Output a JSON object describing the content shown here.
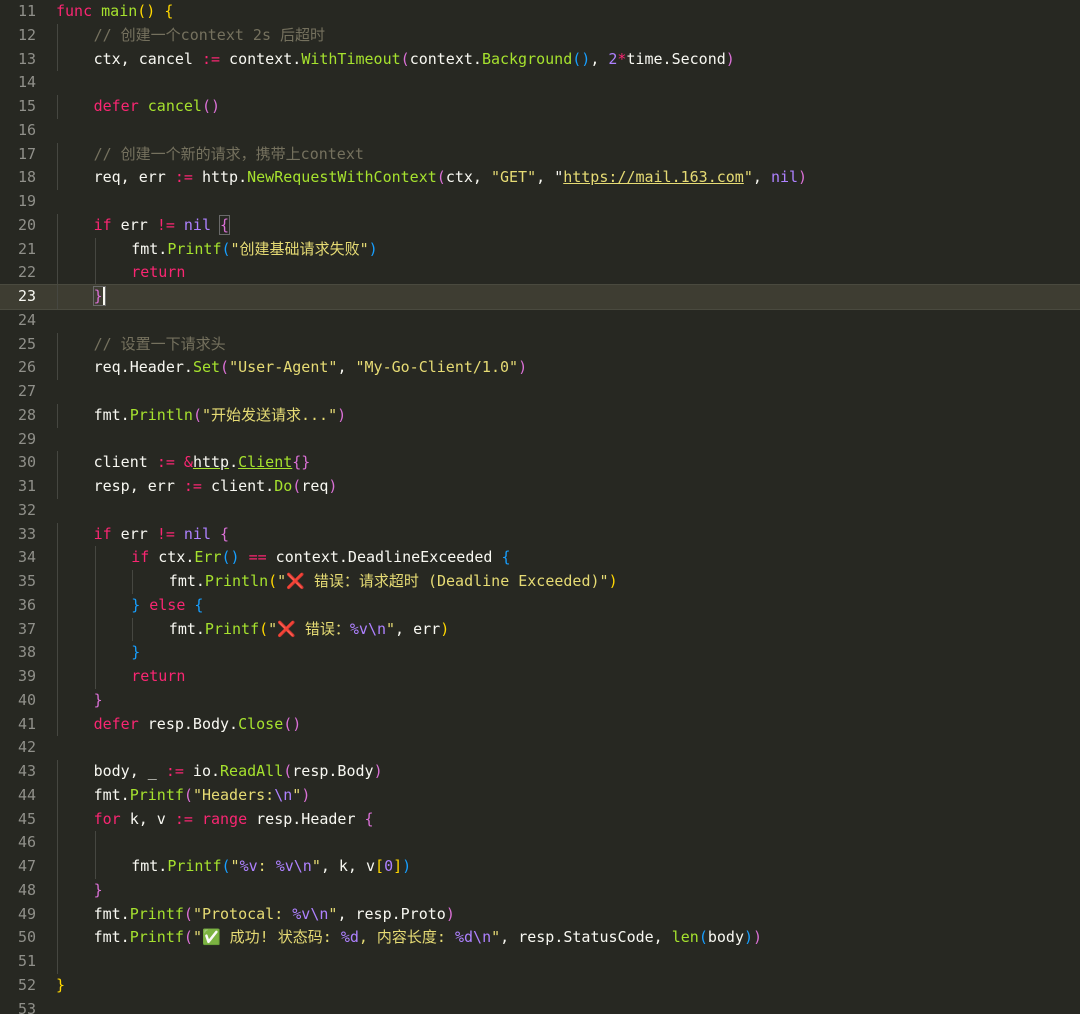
{
  "editor": {
    "language": "go",
    "current_line": 23,
    "colors": {
      "background": "#272822",
      "current_line": "#3e3d32",
      "gutter_text": "#90908a",
      "keyword": "#f92672",
      "function": "#a6e22e",
      "string": "#e6db74",
      "comment": "#75715e",
      "number": "#ae81ff",
      "bracket_level_1": "#ffd700",
      "bracket_level_2": "#da70d6",
      "bracket_level_3": "#179fff"
    },
    "lines": [
      {
        "n": "11",
        "indent": 0,
        "tokens": [
          {
            "t": "func",
            "c": "kw"
          },
          {
            "t": " "
          },
          {
            "t": "main",
            "c": "fn"
          },
          {
            "t": "()",
            "c": "p1"
          },
          {
            "t": " "
          },
          {
            "t": "{",
            "c": "p1"
          }
        ]
      },
      {
        "n": "12",
        "indent": 1,
        "tokens": [
          {
            "t": "// 创建一个context 2s 后超时",
            "c": "com"
          }
        ]
      },
      {
        "n": "13",
        "indent": 1,
        "tokens": [
          {
            "t": "ctx, cancel "
          },
          {
            "t": ":=",
            "c": "kw"
          },
          {
            "t": " context."
          },
          {
            "t": "WithTimeout",
            "c": "fn"
          },
          {
            "t": "(",
            "c": "p2"
          },
          {
            "t": "context."
          },
          {
            "t": "Background",
            "c": "fn"
          },
          {
            "t": "()",
            "c": "p3"
          },
          {
            "t": ", "
          },
          {
            "t": "2",
            "c": "num"
          },
          {
            "t": "*",
            "c": "kw"
          },
          {
            "t": "time.Second"
          },
          {
            "t": ")",
            "c": "p2"
          }
        ]
      },
      {
        "n": "14",
        "indent": 0,
        "tokens": []
      },
      {
        "n": "15",
        "indent": 1,
        "tokens": [
          {
            "t": "defer",
            "c": "kw"
          },
          {
            "t": " "
          },
          {
            "t": "cancel",
            "c": "fn"
          },
          {
            "t": "()",
            "c": "p2"
          }
        ]
      },
      {
        "n": "16",
        "indent": 0,
        "tokens": []
      },
      {
        "n": "17",
        "indent": 1,
        "tokens": [
          {
            "t": "// 创建一个新的请求，携带上context",
            "c": "com"
          }
        ]
      },
      {
        "n": "18",
        "indent": 1,
        "tokens": [
          {
            "t": "req, err "
          },
          {
            "t": ":=",
            "c": "kw"
          },
          {
            "t": " http."
          },
          {
            "t": "NewRequestWithContext",
            "c": "fn"
          },
          {
            "t": "(",
            "c": "p2"
          },
          {
            "t": "ctx, "
          },
          {
            "t": "\"GET\"",
            "c": "str"
          },
          {
            "t": ", "
          },
          {
            "t": "\""
          },
          {
            "t": "https://mail.163.com",
            "c": "str url"
          },
          {
            "t": "\"",
            "c": "str"
          },
          {
            "t": ", "
          },
          {
            "t": "nil",
            "c": "num"
          },
          {
            "t": ")",
            "c": "p2"
          }
        ]
      },
      {
        "n": "19",
        "indent": 0,
        "tokens": []
      },
      {
        "n": "20",
        "indent": 1,
        "tokens": [
          {
            "t": "if",
            "c": "kw"
          },
          {
            "t": " err "
          },
          {
            "t": "!=",
            "c": "kw"
          },
          {
            "t": " "
          },
          {
            "t": "nil",
            "c": "num"
          },
          {
            "t": " "
          },
          {
            "t": "{",
            "c": "p2 box"
          }
        ]
      },
      {
        "n": "21",
        "indent": 2,
        "tokens": [
          {
            "t": "fmt."
          },
          {
            "t": "Printf",
            "c": "fn"
          },
          {
            "t": "(",
            "c": "p3"
          },
          {
            "t": "\"创建基础请求失败\"",
            "c": "str"
          },
          {
            "t": ")",
            "c": "p3"
          }
        ]
      },
      {
        "n": "22",
        "indent": 2,
        "tokens": [
          {
            "t": "return",
            "c": "kw"
          }
        ]
      },
      {
        "n": "23",
        "indent": 1,
        "tokens": [
          {
            "t": "}",
            "c": "p2 box cursor"
          }
        ]
      },
      {
        "n": "24",
        "indent": 0,
        "tokens": []
      },
      {
        "n": "25",
        "indent": 1,
        "tokens": [
          {
            "t": "// 设置一下请求头",
            "c": "com"
          }
        ]
      },
      {
        "n": "26",
        "indent": 1,
        "tokens": [
          {
            "t": "req.Header."
          },
          {
            "t": "Set",
            "c": "fn"
          },
          {
            "t": "(",
            "c": "p2"
          },
          {
            "t": "\"User-Agent\"",
            "c": "str"
          },
          {
            "t": ", "
          },
          {
            "t": "\"My-Go-Client/1.0\"",
            "c": "str"
          },
          {
            "t": ")",
            "c": "p2"
          }
        ]
      },
      {
        "n": "27",
        "indent": 0,
        "tokens": []
      },
      {
        "n": "28",
        "indent": 1,
        "tokens": [
          {
            "t": "fmt."
          },
          {
            "t": "Println",
            "c": "fn"
          },
          {
            "t": "(",
            "c": "p2"
          },
          {
            "t": "\"开始发送请求...\"",
            "c": "str"
          },
          {
            "t": ")",
            "c": "p2"
          }
        ]
      },
      {
        "n": "29",
        "indent": 0,
        "tokens": []
      },
      {
        "n": "30",
        "indent": 1,
        "tokens": [
          {
            "t": "client "
          },
          {
            "t": ":=",
            "c": "kw"
          },
          {
            "t": " "
          },
          {
            "t": "&",
            "c": "kw"
          },
          {
            "t": "http",
            "c": "ul"
          },
          {
            "t": "."
          },
          {
            "t": "Client",
            "c": "fn ul"
          },
          {
            "t": "{}",
            "c": "p2"
          }
        ]
      },
      {
        "n": "31",
        "indent": 1,
        "tokens": [
          {
            "t": "resp, err "
          },
          {
            "t": ":=",
            "c": "kw"
          },
          {
            "t": " client."
          },
          {
            "t": "Do",
            "c": "fn"
          },
          {
            "t": "(",
            "c": "p2"
          },
          {
            "t": "req"
          },
          {
            "t": ")",
            "c": "p2"
          }
        ]
      },
      {
        "n": "32",
        "indent": 0,
        "tokens": []
      },
      {
        "n": "33",
        "indent": 1,
        "tokens": [
          {
            "t": "if",
            "c": "kw"
          },
          {
            "t": " err "
          },
          {
            "t": "!=",
            "c": "kw"
          },
          {
            "t": " "
          },
          {
            "t": "nil",
            "c": "num"
          },
          {
            "t": " "
          },
          {
            "t": "{",
            "c": "p2"
          }
        ]
      },
      {
        "n": "34",
        "indent": 2,
        "tokens": [
          {
            "t": "if",
            "c": "kw"
          },
          {
            "t": " ctx."
          },
          {
            "t": "Err",
            "c": "fn"
          },
          {
            "t": "()",
            "c": "p3"
          },
          {
            "t": " "
          },
          {
            "t": "==",
            "c": "kw"
          },
          {
            "t": " context.DeadlineExceeded "
          },
          {
            "t": "{",
            "c": "p3"
          }
        ]
      },
      {
        "n": "35",
        "indent": 3,
        "tokens": [
          {
            "t": "fmt."
          },
          {
            "t": "Println",
            "c": "fn"
          },
          {
            "t": "(",
            "c": "p1"
          },
          {
            "t": "\"❌ 错误：请求超时 (Deadline Exceeded)\"",
            "c": "str"
          },
          {
            "t": ")",
            "c": "p1"
          }
        ]
      },
      {
        "n": "36",
        "indent": 2,
        "tokens": [
          {
            "t": "}",
            "c": "p3"
          },
          {
            "t": " "
          },
          {
            "t": "else",
            "c": "kw"
          },
          {
            "t": " "
          },
          {
            "t": "{",
            "c": "p3"
          }
        ]
      },
      {
        "n": "37",
        "indent": 3,
        "tokens": [
          {
            "t": "fmt."
          },
          {
            "t": "Printf",
            "c": "fn"
          },
          {
            "t": "(",
            "c": "p1"
          },
          {
            "t": "\"❌ 错误：",
            "c": "str"
          },
          {
            "t": "%v\\n",
            "c": "esc"
          },
          {
            "t": "\"",
            "c": "str"
          },
          {
            "t": ", err"
          },
          {
            "t": ")",
            "c": "p1"
          }
        ]
      },
      {
        "n": "38",
        "indent": 2,
        "tokens": [
          {
            "t": "}",
            "c": "p3"
          }
        ]
      },
      {
        "n": "39",
        "indent": 2,
        "tokens": [
          {
            "t": "return",
            "c": "kw"
          }
        ]
      },
      {
        "n": "40",
        "indent": 1,
        "tokens": [
          {
            "t": "}",
            "c": "p2"
          }
        ]
      },
      {
        "n": "41",
        "indent": 1,
        "tokens": [
          {
            "t": "defer",
            "c": "kw"
          },
          {
            "t": " resp.Body."
          },
          {
            "t": "Close",
            "c": "fn"
          },
          {
            "t": "()",
            "c": "p2"
          }
        ]
      },
      {
        "n": "42",
        "indent": 0,
        "tokens": []
      },
      {
        "n": "43",
        "indent": 1,
        "tokens": [
          {
            "t": "body, _ "
          },
          {
            "t": ":=",
            "c": "kw"
          },
          {
            "t": " io."
          },
          {
            "t": "ReadAll",
            "c": "fn"
          },
          {
            "t": "(",
            "c": "p2"
          },
          {
            "t": "resp.Body"
          },
          {
            "t": ")",
            "c": "p2"
          }
        ]
      },
      {
        "n": "44",
        "indent": 1,
        "tokens": [
          {
            "t": "fmt."
          },
          {
            "t": "Printf",
            "c": "fn"
          },
          {
            "t": "(",
            "c": "p2"
          },
          {
            "t": "\"Headers:",
            "c": "str"
          },
          {
            "t": "\\n",
            "c": "esc"
          },
          {
            "t": "\"",
            "c": "str"
          },
          {
            "t": ")",
            "c": "p2"
          }
        ]
      },
      {
        "n": "45",
        "indent": 1,
        "tokens": [
          {
            "t": "for",
            "c": "kw"
          },
          {
            "t": " k, v "
          },
          {
            "t": ":=",
            "c": "kw"
          },
          {
            "t": " "
          },
          {
            "t": "range",
            "c": "kw"
          },
          {
            "t": " resp.Header "
          },
          {
            "t": "{",
            "c": "p2"
          }
        ]
      },
      {
        "n": "46",
        "indent": 2,
        "tokens": []
      },
      {
        "n": "47",
        "indent": 2,
        "tokens": [
          {
            "t": "fmt."
          },
          {
            "t": "Printf",
            "c": "fn"
          },
          {
            "t": "(",
            "c": "p3"
          },
          {
            "t": "\"",
            "c": "str"
          },
          {
            "t": "%v",
            "c": "esc"
          },
          {
            "t": ": ",
            "c": "str"
          },
          {
            "t": "%v\\n",
            "c": "esc"
          },
          {
            "t": "\"",
            "c": "str"
          },
          {
            "t": ", k, v"
          },
          {
            "t": "[",
            "c": "p1"
          },
          {
            "t": "0",
            "c": "num"
          },
          {
            "t": "]",
            "c": "p1"
          },
          {
            "t": ")",
            "c": "p3"
          }
        ]
      },
      {
        "n": "48",
        "indent": 1,
        "tokens": [
          {
            "t": "}",
            "c": "p2"
          }
        ]
      },
      {
        "n": "49",
        "indent": 1,
        "tokens": [
          {
            "t": "fmt."
          },
          {
            "t": "Printf",
            "c": "fn"
          },
          {
            "t": "(",
            "c": "p2"
          },
          {
            "t": "\"Protocal: ",
            "c": "str"
          },
          {
            "t": "%v\\n",
            "c": "esc"
          },
          {
            "t": "\"",
            "c": "str"
          },
          {
            "t": ", resp.Proto"
          },
          {
            "t": ")",
            "c": "p2"
          }
        ]
      },
      {
        "n": "50",
        "indent": 1,
        "tokens": [
          {
            "t": "fmt."
          },
          {
            "t": "Printf",
            "c": "fn"
          },
          {
            "t": "(",
            "c": "p2"
          },
          {
            "t": "\"✅ 成功! 状态码: ",
            "c": "str"
          },
          {
            "t": "%d",
            "c": "esc"
          },
          {
            "t": ", 内容长度: ",
            "c": "str"
          },
          {
            "t": "%d\\n",
            "c": "esc"
          },
          {
            "t": "\"",
            "c": "str"
          },
          {
            "t": ", resp.StatusCode, "
          },
          {
            "t": "len",
            "c": "fn"
          },
          {
            "t": "(",
            "c": "p3"
          },
          {
            "t": "body"
          },
          {
            "t": ")",
            "c": "p3"
          },
          {
            "t": ")",
            "c": "p2"
          }
        ]
      },
      {
        "n": "51",
        "indent": 1,
        "tokens": []
      },
      {
        "n": "52",
        "indent": 0,
        "tokens": [
          {
            "t": "}",
            "c": "p1"
          }
        ]
      },
      {
        "n": "53",
        "indent": 0,
        "tokens": []
      }
    ]
  }
}
